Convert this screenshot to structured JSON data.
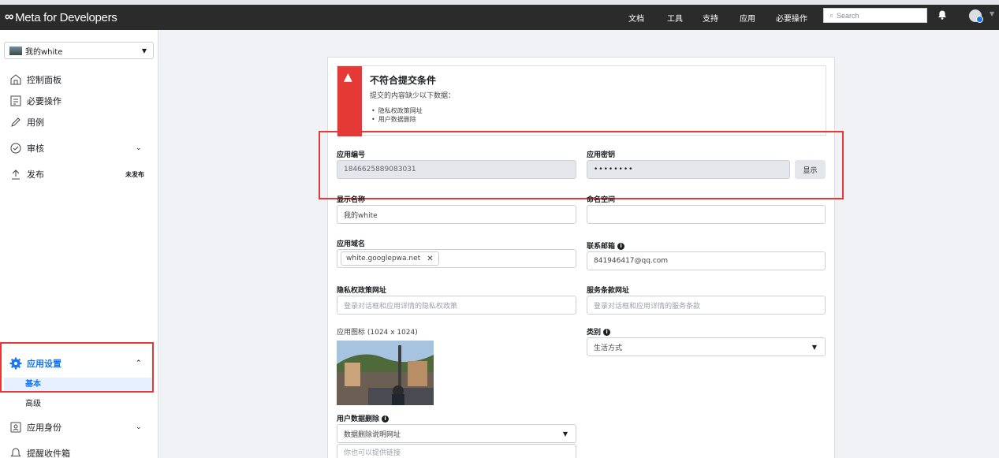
{
  "topbar": {
    "brand": "Meta for Developers",
    "nav": [
      "文档",
      "工具",
      "支持",
      "应用",
      "必要操作"
    ],
    "search_placeholder": "Search"
  },
  "sidebar": {
    "app_name": "我的white",
    "items": [
      {
        "label": "控制面板",
        "icon": "dashboard-icon"
      },
      {
        "label": "必要操作",
        "icon": "checklist-icon"
      },
      {
        "label": "用例",
        "icon": "pencil-icon"
      },
      {
        "label": "审核",
        "icon": "check-circle-icon"
      },
      {
        "label": "发布",
        "icon": "publish-icon",
        "badge": "未发布"
      }
    ],
    "settings": {
      "label": "应用设置",
      "sub": [
        "基本",
        "高级"
      ]
    },
    "bottom_items": [
      {
        "label": "应用身份",
        "icon": "id-card-icon"
      },
      {
        "label": "提醒收件箱",
        "icon": "bell-icon"
      }
    ]
  },
  "alert": {
    "title": "不符合提交条件",
    "desc": "提交的内容缺少以下数据：",
    "items": [
      "隐私权政策网址",
      "用户数据删除"
    ]
  },
  "form": {
    "app_id_label": "应用编号",
    "app_id": "1846625889083031",
    "app_secret_label": "应用密钥",
    "app_secret": "••••••••",
    "show_label": "显示",
    "display_name_label": "显示名称",
    "display_name": "我的white",
    "namespace_label": "命名空间",
    "namespace": "",
    "domain_label": "应用域名",
    "domain_tag": "white.googlepwa.net",
    "contact_label": "联系邮箱",
    "contact": "841946417@qq.com",
    "privacy_label": "隐私权政策网址",
    "privacy_placeholder": "登录对话框和应用详情的隐私权政策",
    "tos_label": "服务条款网址",
    "tos_placeholder": "登录对话框和应用详情的服务条款",
    "icon_label": "应用图标 (1024 x 1024)",
    "category_label": "类别",
    "category": "生活方式",
    "deletion_label": "用户数据删除",
    "deletion_select": "数据删除说明网址",
    "deletion_placeholder": "你也可以提供链接"
  }
}
